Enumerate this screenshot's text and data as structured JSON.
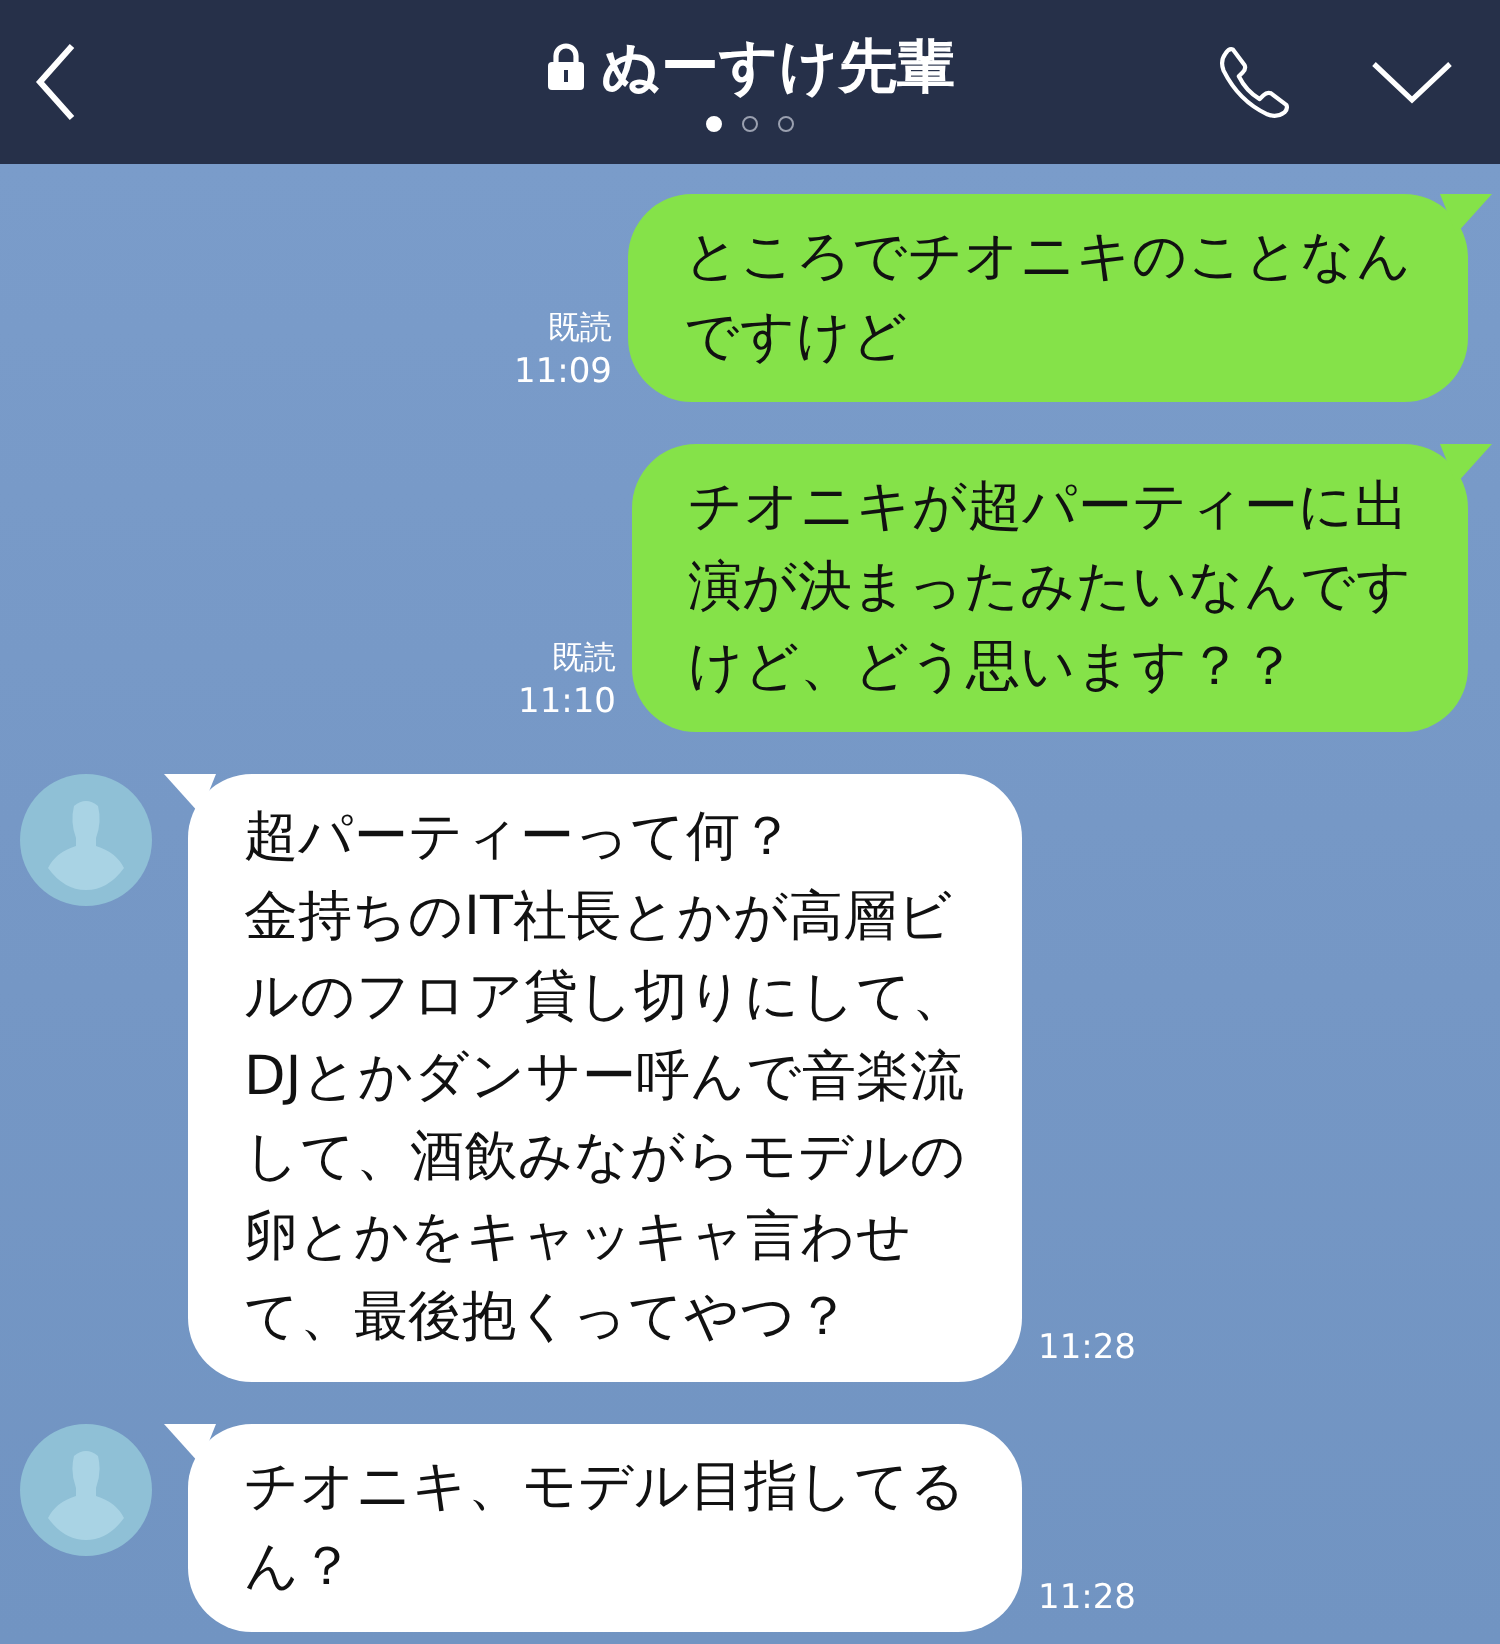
{
  "header": {
    "title": "ぬーすけ先輩",
    "locked": true,
    "pages": [
      {
        "selected": true
      },
      {
        "selected": false
      },
      {
        "selected": false
      }
    ]
  },
  "messages": [
    {
      "kind": "sent",
      "lines": [
        "ところでチオニキのことなん",
        "ですけど"
      ],
      "read": "既読",
      "time": "11:09"
    },
    {
      "kind": "sent",
      "lines": [
        "チオニキが超パーティーに出",
        "演が決まったみたいなんです",
        "けど、どう思います？？"
      ],
      "read": "既読",
      "time": "11:10"
    },
    {
      "kind": "received",
      "lines": [
        "超パーティーって何？",
        "金持ちのIT社長とかが高層ビ",
        "ルのフロア貸し切りにして、",
        "DJとかダンサー呼んで音楽流",
        "して、酒飲みながらモデルの",
        "卵とかをキャッキャ言わせ",
        "て、最後抱くってやつ？"
      ],
      "time": "11:28"
    },
    {
      "kind": "received",
      "lines": [
        "チオニキ、モデル目指してる",
        "ん？"
      ],
      "time": "11:28"
    }
  ]
}
